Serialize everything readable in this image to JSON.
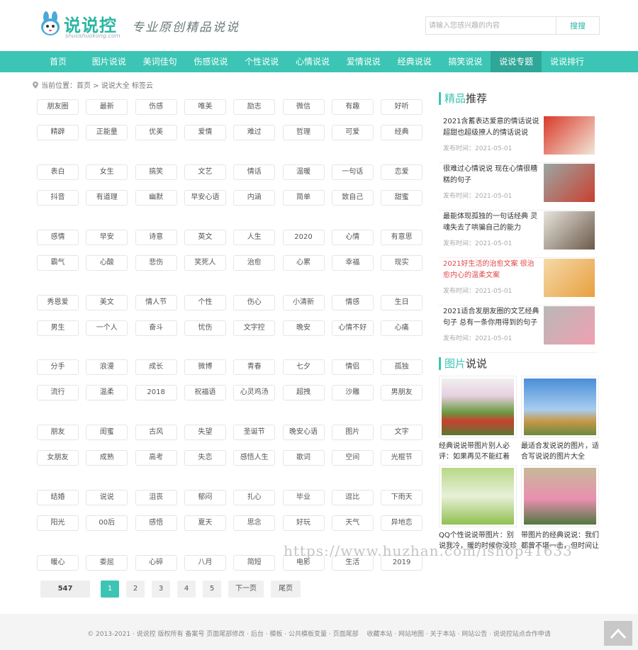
{
  "header": {
    "logo_text": "说说控",
    "logo_domain": "shuoshuokong.com",
    "slogan": "专业原创精品说说",
    "search_placeholder": "请输入您感兴趣的内容",
    "search_button": "搜搜"
  },
  "nav": [
    "首页",
    "图片说说",
    "美词佳句",
    "伤感说说",
    "个性说说",
    "心情说说",
    "爱情说说",
    "经典说说",
    "搞笑说说",
    "说说专题",
    "说说排行"
  ],
  "nav_active": "说说专题",
  "breadcrumb": "当前位置：首页 > 说说大全 标签云",
  "tags": [
    "朋友圈",
    "最新",
    "伤感",
    "唯美",
    "励志",
    "微信",
    "有趣",
    "好听",
    "精辟",
    "正能量",
    "优美",
    "爱情",
    "难过",
    "哲理",
    "可爱",
    "经典",
    "表白",
    "女生",
    "搞笑",
    "文艺",
    "情话",
    "温暖",
    "一句话",
    "恋爱",
    "抖音",
    "有道理",
    "幽默",
    "早安心语",
    "内涵",
    "简单",
    "致自己",
    "甜蜜",
    "感情",
    "早安",
    "诗意",
    "英文",
    "人生",
    "2020",
    "心情",
    "有意思",
    "霸气",
    "心酸",
    "悲伤",
    "笑死人",
    "治愈",
    "心累",
    "幸福",
    "现实",
    "秀恩爱",
    "美文",
    "情人节",
    "个性",
    "伤心",
    "小清新",
    "情感",
    "生日",
    "男生",
    "一个人",
    "奋斗",
    "忧伤",
    "文字控",
    "晚安",
    "心情不好",
    "心痛",
    "分手",
    "浪漫",
    "成长",
    "微博",
    "青春",
    "七夕",
    "情侣",
    "孤独",
    "流行",
    "温柔",
    "2018",
    "祝福语",
    "心灵鸡汤",
    "超拽",
    "沙雕",
    "男朋友",
    "朋友",
    "闺蜜",
    "古风",
    "失望",
    "圣诞节",
    "晚安心语",
    "图片",
    "文字",
    "女朋友",
    "成熟",
    "高考",
    "失恋",
    "感悟人生",
    "歌词",
    "空间",
    "光棍节",
    "结婚",
    "说说",
    "沮丧",
    "郁闷",
    "扎心",
    "毕业",
    "逗比",
    "下雨天",
    "阳光",
    "00后",
    "感悟",
    "夏天",
    "思念",
    "好玩",
    "天气",
    "异地恋",
    "暖心",
    "委屈",
    "心碎",
    "八月",
    "简短",
    "电影",
    "生活",
    "2019"
  ],
  "pagination": {
    "total": "547",
    "pages": [
      "1",
      "2",
      "3",
      "4",
      "5"
    ],
    "current": "1",
    "next": "下一页",
    "last": "尾页"
  },
  "recommend": {
    "title_highlight": "精品",
    "title_rest": "推荐",
    "items": [
      {
        "title": "2021含蓄表达爱意的情话说说 超甜也超级撩人的情话说说",
        "date": "发布时间：2021-05-01",
        "red": false
      },
      {
        "title": "很难过心情说说 现在心情很糟糕的句子",
        "date": "发布时间：2021-05-01",
        "red": false
      },
      {
        "title": "最能体现孤独的一句话经典 灵魂失去了哄骗自己的能力",
        "date": "发布时间：2021-05-01",
        "red": false
      },
      {
        "title": "2021好生活的治愈文案 很治愈内心的温柔文案",
        "date": "发布时间：2021-05-01",
        "red": true
      },
      {
        "title": "2021适合发朋友圈的文艺经典句子 总有一条你用得到的句子",
        "date": "发布时间：2021-05-01",
        "red": false
      }
    ]
  },
  "pictures": {
    "title_highlight": "图片",
    "title_rest": "说说",
    "items": [
      {
        "caption": "经典说说带图片别人必评：如果再见不能红着"
      },
      {
        "caption": "最适合发说说的图片，适合写说说的图片大全"
      },
      {
        "caption": "QQ个性说说带图片：别说我冷，暖的时候你没珍"
      },
      {
        "caption": "带图片的经典说说：我们都曾不堪一击，但时间让"
      }
    ]
  },
  "footer": "© 2013-2021 · 说说控 版权所有 备案号 页面尾部修改 · 后台 · 模板 · 公共模板变量 · 页面尾部　 收藏本站 · 网站地图 · 关于本站 · 网站公告 · 说说控站点合作申请",
  "watermark": "https://www.huzhan.com/ishop41633",
  "colors": {
    "accent": "#3cc5b4",
    "nav_active": "#2fa697",
    "red_title": "#e04848"
  }
}
